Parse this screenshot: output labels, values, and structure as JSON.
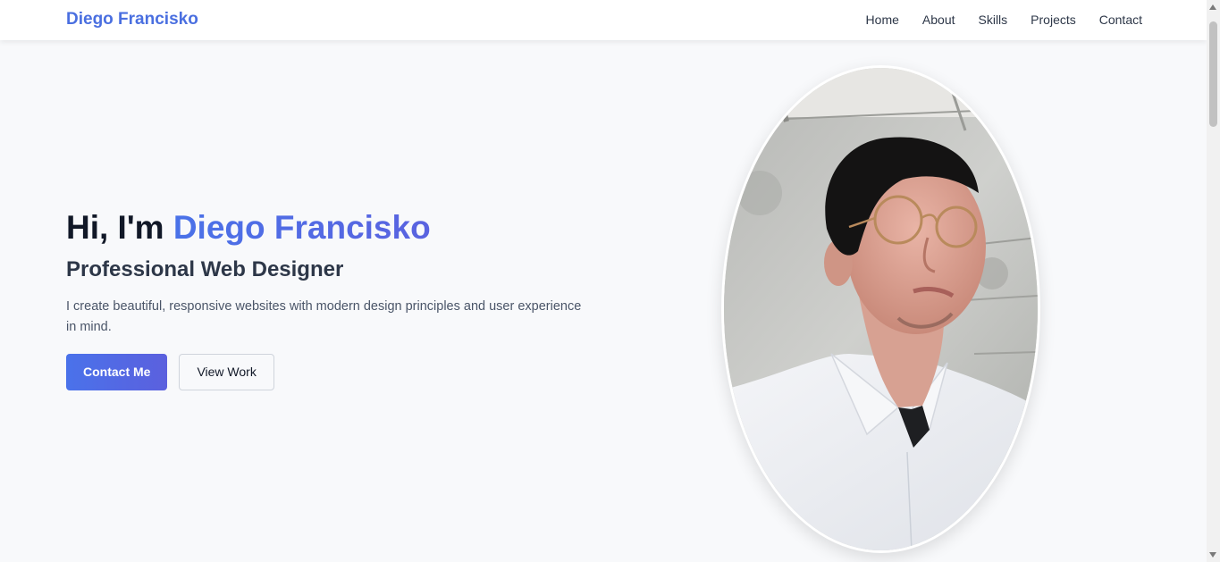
{
  "nav": {
    "brand": "Diego Francisko",
    "links": [
      "Home",
      "About",
      "Skills",
      "Projects",
      "Contact"
    ]
  },
  "hero": {
    "greeting": "Hi, I'm ",
    "name": "Diego Francisko",
    "subtitle": "Professional Web Designer",
    "description": "I create beautiful, responsive websites with modern design principles and user experience in mind.",
    "primary_button": "Contact Me",
    "secondary_button": "View Work"
  },
  "colors": {
    "accent": "#4a6fe0",
    "gradient_start": "#4a72ea",
    "gradient_end": "#5b60de",
    "background": "#f8f9fb"
  }
}
